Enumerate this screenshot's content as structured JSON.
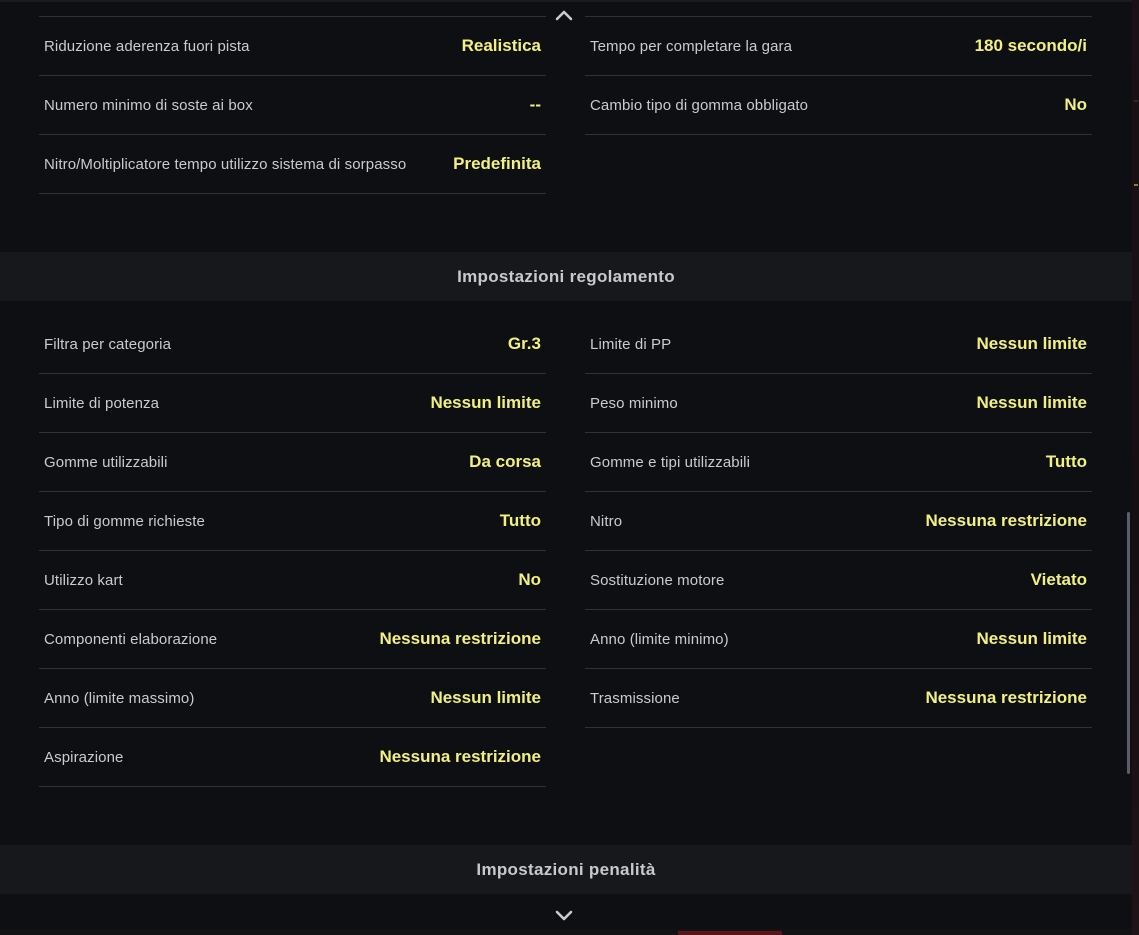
{
  "icons": {
    "scroll_up": "chevron-up-icon",
    "scroll_down": "chevron-down-icon"
  },
  "colors": {
    "background": "#0e0f12",
    "section_header_bg": "#17181c",
    "label_text": "#c9cbcf",
    "value_text": "#f2f080",
    "divider": "#303236"
  },
  "race_settings": {
    "left": [
      {
        "label": "Riduzione aderenza fuori pista",
        "value": "Realistica"
      },
      {
        "label": "Numero minimo di soste ai box",
        "value": "--"
      },
      {
        "label": "Nitro/Moltiplicatore tempo utilizzo sistema di sorpasso",
        "value": "Predefinita"
      }
    ],
    "right": [
      {
        "label": "Tempo per completare la gara",
        "value": "180 secondo/i"
      },
      {
        "label": "Cambio tipo di gomma obbligato",
        "value": "No"
      }
    ]
  },
  "regulation": {
    "title": "Impostazioni regolamento",
    "left": [
      {
        "label": "Filtra per categoria",
        "value": "Gr.3"
      },
      {
        "label": "Limite di potenza",
        "value": "Nessun limite"
      },
      {
        "label": "Gomme utilizzabili",
        "value": "Da corsa"
      },
      {
        "label": "Tipo di gomme richieste",
        "value": "Tutto"
      },
      {
        "label": "Utilizzo kart",
        "value": "No"
      },
      {
        "label": "Componenti elaborazione",
        "value": "Nessuna restrizione"
      },
      {
        "label": "Anno (limite massimo)",
        "value": "Nessun limite"
      },
      {
        "label": "Aspirazione",
        "value": "Nessuna restrizione"
      }
    ],
    "right": [
      {
        "label": "Limite di PP",
        "value": "Nessun limite"
      },
      {
        "label": "Peso minimo",
        "value": "Nessun limite"
      },
      {
        "label": "Gomme e tipi utilizzabili",
        "value": "Tutto"
      },
      {
        "label": "Nitro",
        "value": "Nessuna restrizione"
      },
      {
        "label": "Sostituzione motore",
        "value": "Vietato"
      },
      {
        "label": "Anno (limite minimo)",
        "value": "Nessun limite"
      },
      {
        "label": "Trasmissione",
        "value": "Nessuna restrizione"
      }
    ]
  },
  "penalty": {
    "title": "Impostazioni penalità"
  }
}
